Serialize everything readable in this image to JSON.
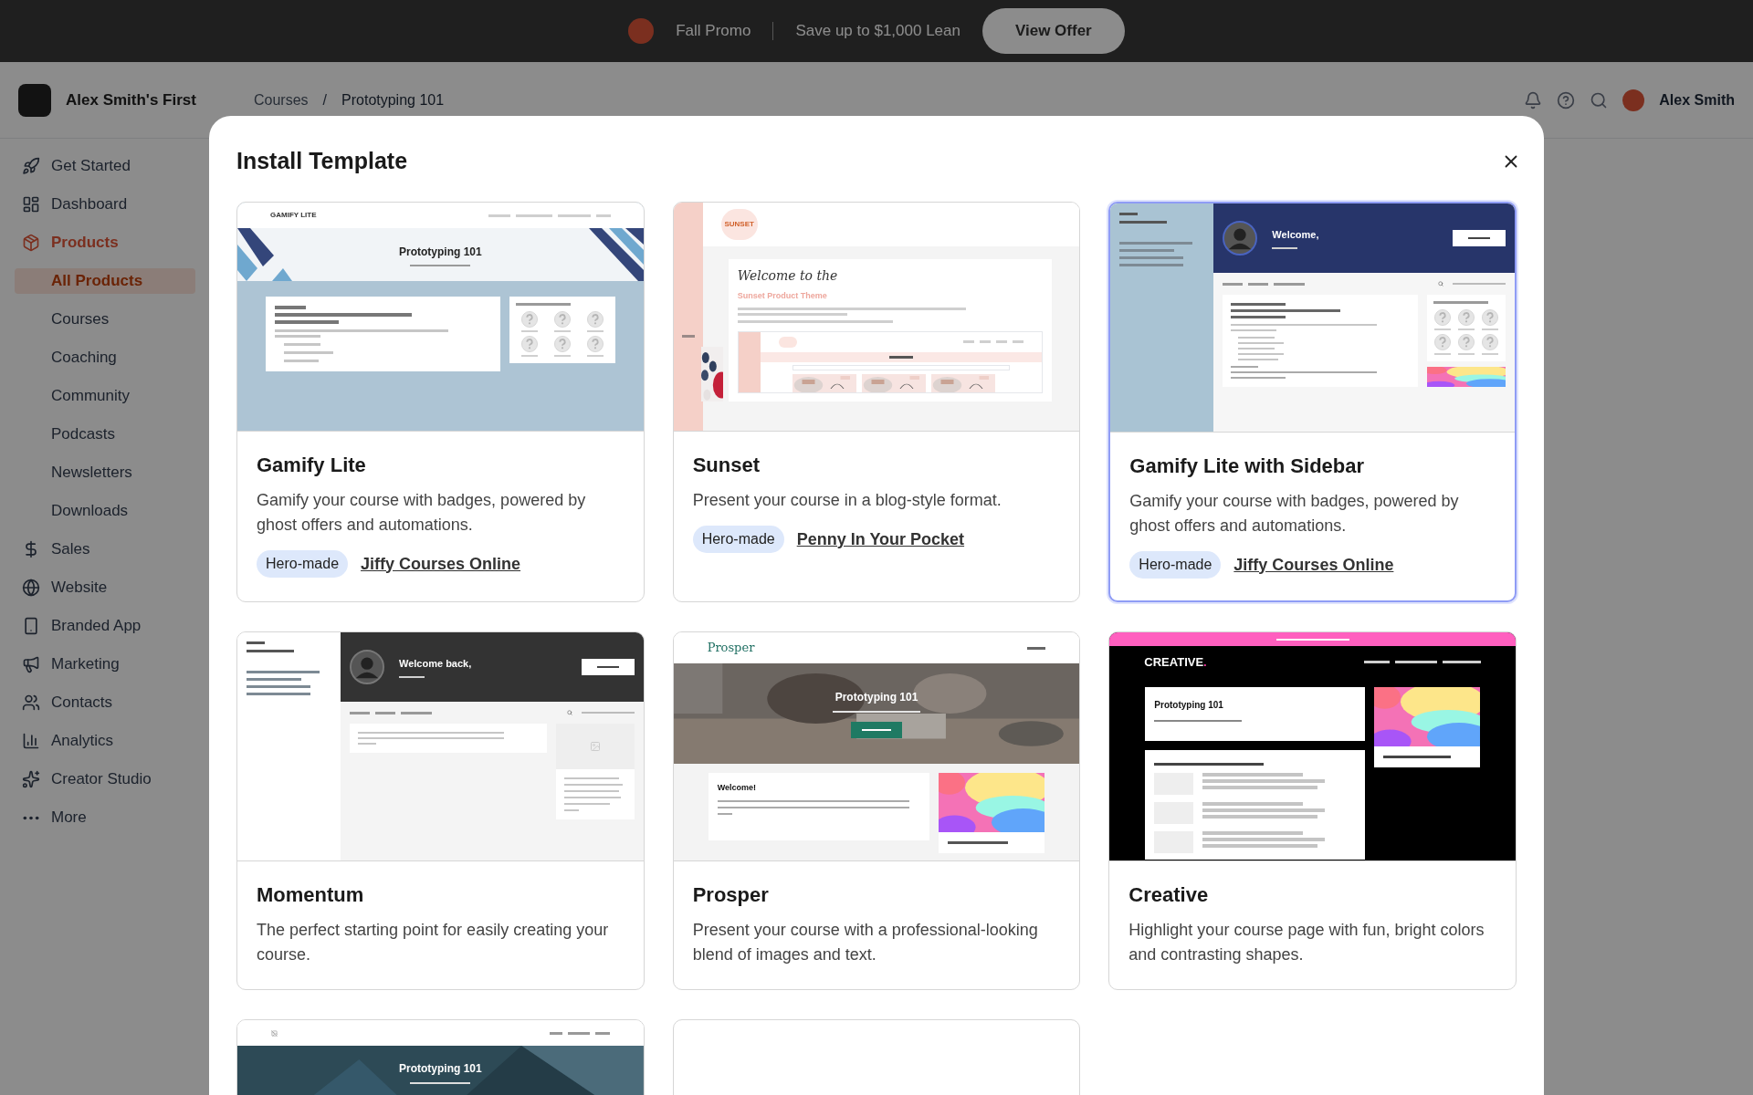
{
  "promo_banner": {
    "title": "Fall Promo",
    "text": "Save up to $1,000 Lean",
    "button": "View Offer"
  },
  "app_header": {
    "site": "Alex Smith's First",
    "breadcrumb": [
      "Courses",
      "Prototyping 101"
    ],
    "separator": "/",
    "user": "Alex Smith"
  },
  "sidebar": {
    "items": [
      {
        "label": "Get Started",
        "selected": false
      },
      {
        "label": "Dashboard",
        "selected": false
      },
      {
        "label": "Products",
        "selected": true,
        "children": [
          {
            "label": "All Products",
            "selected": true
          },
          {
            "label": "Courses",
            "selected": false
          },
          {
            "label": "Coaching",
            "selected": false
          },
          {
            "label": "Community",
            "selected": false
          },
          {
            "label": "Podcasts",
            "selected": false
          },
          {
            "label": "Newsletters",
            "selected": false
          },
          {
            "label": "Downloads",
            "selected": false
          }
        ]
      },
      {
        "label": "Sales",
        "selected": false
      },
      {
        "label": "Website",
        "selected": false
      },
      {
        "label": "Branded App",
        "selected": false
      },
      {
        "label": "Marketing",
        "selected": false
      },
      {
        "label": "Contacts",
        "selected": false
      },
      {
        "label": "Analytics",
        "selected": false
      },
      {
        "label": "Creator Studio",
        "selected": false
      },
      {
        "label": "More",
        "selected": false
      }
    ]
  },
  "modal": {
    "title": "Install Template"
  },
  "templates": [
    {
      "name": "Gamify Lite",
      "description": "Gamify your course with badges, powered by ghost offers and automations.",
      "tag": "Hero-made",
      "author": "Jiffy Courses Online",
      "selected": false,
      "preview": {
        "kind": "gamify",
        "brand": "GAMIFY LITE",
        "title": "Prototyping 101"
      }
    },
    {
      "name": "Sunset",
      "description": "Present your course in a blog-style format.",
      "tag": "Hero-made",
      "author": "Penny In Your Pocket",
      "selected": false,
      "preview": {
        "kind": "sunset",
        "logo": "SUNSET",
        "script": "Welcome to the",
        "heading": "Sunset Product Theme"
      }
    },
    {
      "name": "Gamify Lite with Sidebar",
      "description": "Gamify your course with badges, powered by ghost offers and automations.",
      "tag": "Hero-made",
      "author": "Jiffy Courses Online",
      "selected": true,
      "preview": {
        "kind": "sidebar",
        "welcome": "Welcome,"
      }
    },
    {
      "name": "Momentum",
      "description": "The perfect starting point for easily creating your course.",
      "selected": false,
      "preview": {
        "kind": "momentum",
        "welcome": "Welcome back,"
      }
    },
    {
      "name": "Prosper",
      "description": "Present your course with a professional-looking blend of images and text.",
      "selected": false,
      "preview": {
        "kind": "prosper",
        "brand": "Prosper",
        "title": "Prototyping 101",
        "heading": "Welcome!"
      }
    },
    {
      "name": "Creative",
      "description": "Highlight your course page with fun, bright colors and contrasting shapes.",
      "selected": false,
      "preview": {
        "kind": "creative",
        "brand": "CREATIVE.",
        "title": "Prototyping 101"
      }
    },
    {
      "selected": false,
      "preview": {
        "kind": "store",
        "title": "Prototyping 101"
      }
    },
    {
      "selected": false,
      "preview": {
        "kind": "blank"
      }
    }
  ]
}
